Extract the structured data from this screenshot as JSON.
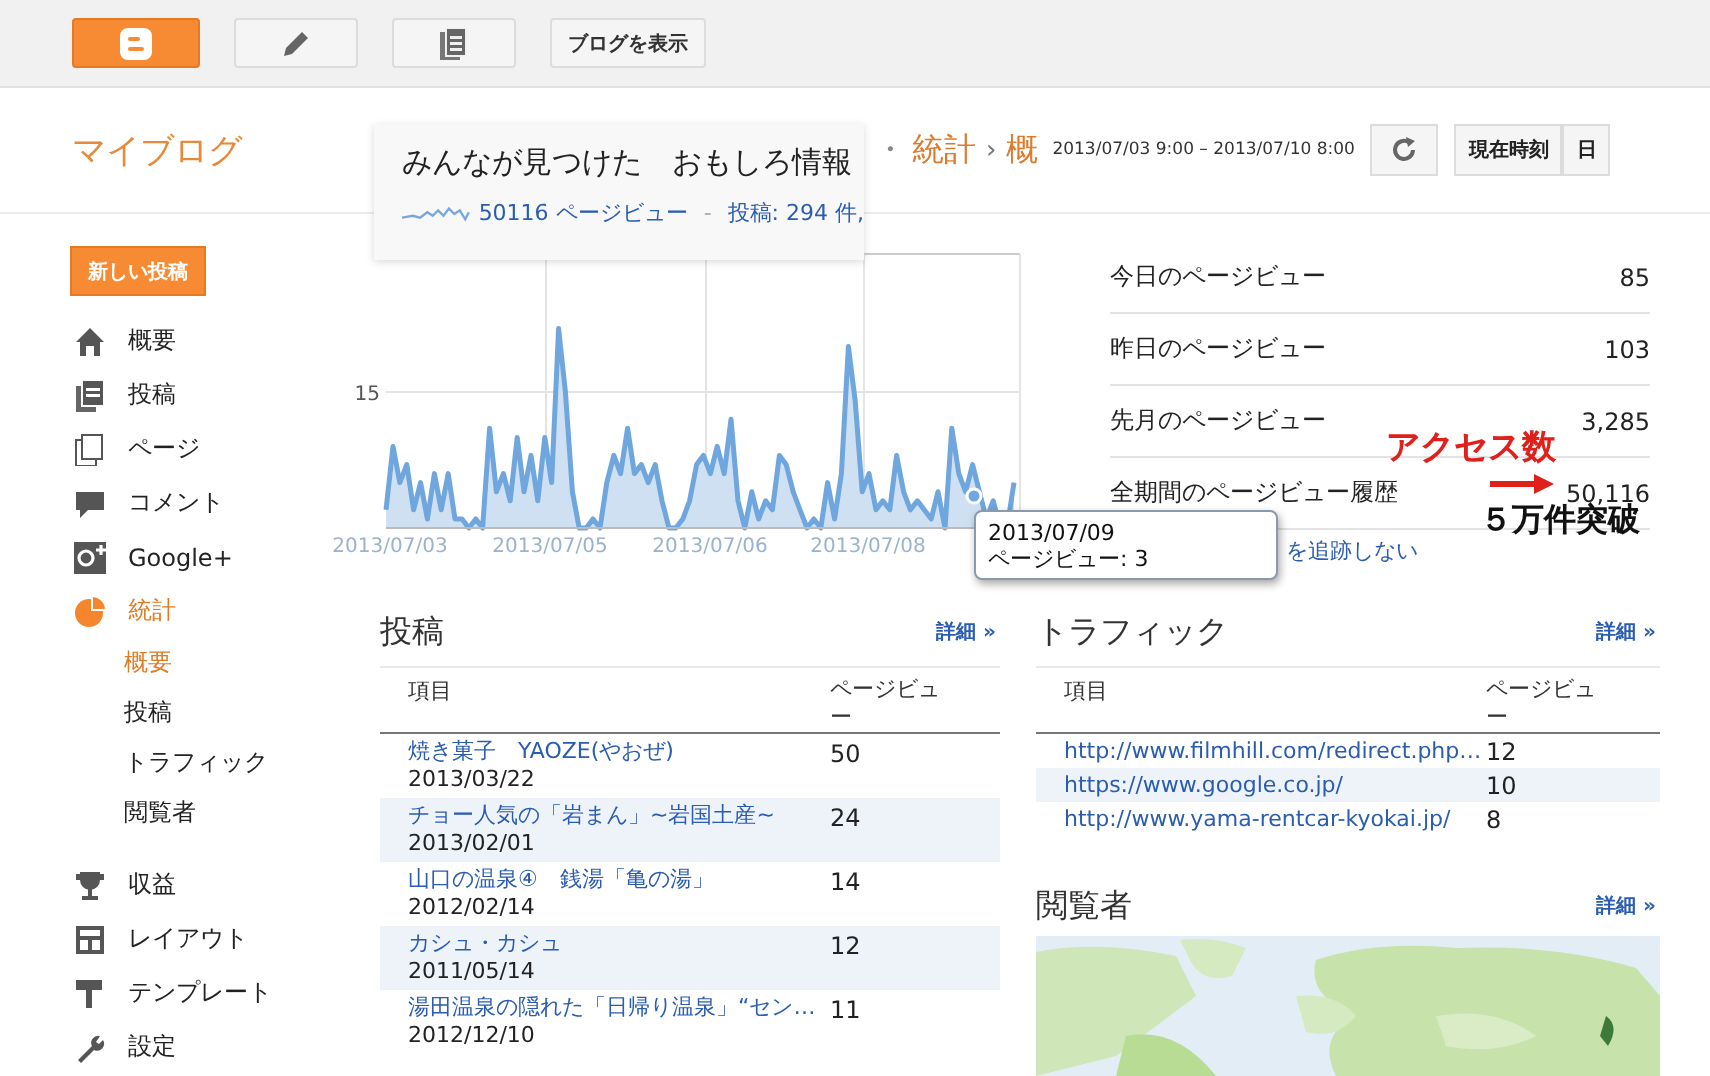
{
  "toolbar": {
    "view_blog": "ブログを表示"
  },
  "header": {
    "blog_title": "マイブログ",
    "breadcrumb": {
      "lead": "・",
      "items": [
        "統計",
        "概"
      ],
      "separator": "›"
    },
    "date_range": "2013/07/03 9:00 – 2013/07/10 8:00",
    "range_buttons": [
      "現在時刻",
      "日"
    ]
  },
  "sidebar": {
    "new_post": "新しい投稿",
    "items": [
      {
        "label": "概要",
        "selected": false
      },
      {
        "label": "投稿",
        "selected": false
      },
      {
        "label": "ページ",
        "selected": false
      },
      {
        "label": "コメント",
        "selected": false
      },
      {
        "label": "Google+",
        "selected": false
      },
      {
        "label": "統計",
        "selected": true,
        "children": [
          {
            "label": "概要",
            "selected": true
          },
          {
            "label": "投稿",
            "selected": false
          },
          {
            "label": "トラフィック",
            "selected": false
          },
          {
            "label": "閲覧者",
            "selected": false
          }
        ]
      },
      {
        "label": "収益",
        "selected": false
      },
      {
        "label": "レイアウト",
        "selected": false
      },
      {
        "label": "テンプレート",
        "selected": false
      },
      {
        "label": "設定",
        "selected": false
      }
    ]
  },
  "popup": {
    "title": "みんなが見つけた　おもしろ情報",
    "pageviews": "50116 ページビュー",
    "separator": "-",
    "posts": "投稿: 294 件,"
  },
  "chart": {
    "y_tick": "15",
    "x_labels": [
      "2013/07/03",
      "2013/07/05",
      "2013/07/06",
      "2013/07/08"
    ]
  },
  "tooltip": {
    "date": "2013/07/09",
    "value": "ページビュー: 3"
  },
  "stats": [
    {
      "label": "今日のページビュー",
      "value": "85"
    },
    {
      "label": "昨日のページビュー",
      "value": "103"
    },
    {
      "label": "先月のページビュー",
      "value": "3,285"
    },
    {
      "label": "全期間のページビュー履歴",
      "value": "50,116"
    }
  ],
  "tracking_link": "を追跡しない",
  "annotation": {
    "title": "アクセス数",
    "caption": "５万件突破"
  },
  "posts": {
    "title": "投稿",
    "details": "詳細 »",
    "columns": [
      "項目",
      "ページビュー"
    ],
    "rows": [
      {
        "title": "焼き菓子　YAOZE(やおぜ)",
        "date": "2013/03/22",
        "views": "50"
      },
      {
        "title": "チョー人気の「岩まん」~岩国土産~",
        "date": "2013/02/01",
        "views": "24"
      },
      {
        "title": "山口の温泉④　銭湯「亀の湯」",
        "date": "2012/02/14",
        "views": "14"
      },
      {
        "title": "カシュ・カシュ",
        "date": "2011/05/14",
        "views": "12"
      },
      {
        "title": "湯田温泉の隠れた「日帰り温泉」“セン…",
        "date": "2012/12/10",
        "views": "11"
      }
    ]
  },
  "traffic": {
    "title": "トラフィック",
    "details": "詳細 »",
    "columns": [
      "項目",
      "ページビュー"
    ],
    "rows": [
      {
        "url": "http://www.filmhill.com/redirect.php…",
        "views": "12"
      },
      {
        "url": "https://www.google.co.jp/",
        "views": "10"
      },
      {
        "url": "http://www.yama-rentcar-kyokai.jp/",
        "views": "8"
      }
    ]
  },
  "audience": {
    "title": "閲覧者",
    "details": "詳細 »"
  }
}
